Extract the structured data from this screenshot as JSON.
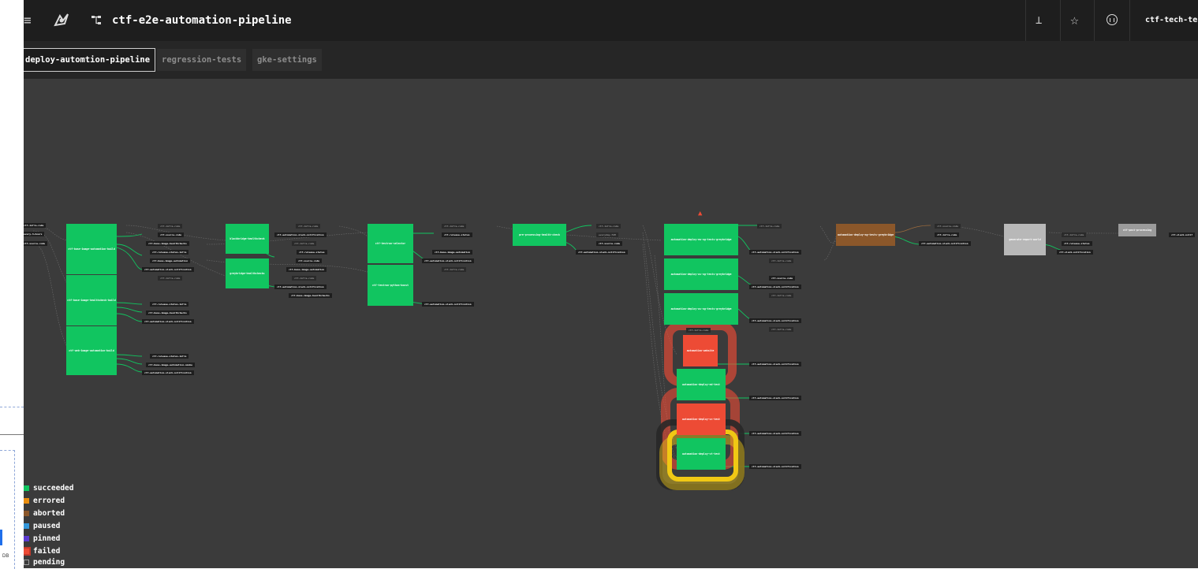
{
  "topbar": {
    "pipeline_name": "ctf-e2e-automation-pipeline",
    "team_label": "ctf-tech-tes"
  },
  "groups": [
    {
      "label": "deploy-automtion-pipeline",
      "active": true
    },
    {
      "label": "regression-tests",
      "active": false
    },
    {
      "label": "gke-settings",
      "active": false
    }
  ],
  "jobs": [
    {
      "name": "ctf-base-image-automation-build",
      "status": "succeeded"
    },
    {
      "name": "ctf-base-image-healthcheck-build",
      "status": "succeeded"
    },
    {
      "name": "ctf-web-image-automation-build",
      "status": "succeeded"
    },
    {
      "name": "blackbridge-healthcheck",
      "status": "succeeded"
    },
    {
      "name": "greybridge-healthchecks",
      "status": "succeeded"
    },
    {
      "name": "ctf-testrun-selector",
      "status": "succeeded"
    },
    {
      "name": "ctf-testrun-python-boost",
      "status": "succeeded"
    },
    {
      "name": "pre-processing-health-check",
      "status": "succeeded"
    },
    {
      "name": "automation-deploy-eu-ng-tests-greybridge",
      "status": "succeeded"
    },
    {
      "name": "automation-deploy-us-ng-tests-greybridge",
      "status": "succeeded"
    },
    {
      "name": "automation-deploy-us-ng-tests-greybridge",
      "status": "succeeded"
    },
    {
      "name": "automation-website",
      "status": "failed"
    },
    {
      "name": "automation-deploy-ed-test",
      "status": "succeeded"
    },
    {
      "name": "automation-deploy-vc-test",
      "status": "failed"
    },
    {
      "name": "automation-deploy-vt-test",
      "status": "succeeded"
    },
    {
      "name": "automation-deploy-ng-tests-greybridge",
      "status": "aborted"
    },
    {
      "name": "generate-report-world",
      "status": "pending"
    },
    {
      "name": "ctf-post-processing",
      "status": "pending"
    }
  ],
  "resources": {
    "left_inputs": [
      "ctf-infra-code",
      "every-3-hours",
      "ctf-source-code"
    ],
    "col1_a": [
      "ctf-infra-code",
      "ctf-source-code",
      "ctf-base-image-healthchecks",
      "ctf-release-status-infra",
      "ctf-base-image-automation",
      "ctf-automation-slack-notification"
    ],
    "col1_b": [
      "ctf-infra-code",
      "ctf-release-status-infra",
      "ctf-base-image-healthchecks",
      "ctf-automation-slack-notification"
    ],
    "col1_c": [
      "ctf-release-status-infra",
      "ctf-base-image-automation-smoke",
      "ctf-automation-slack-notification"
    ],
    "col2": [
      "ctf-infra-code",
      "ctf-automation-slack-notification",
      "ctf-infra-code",
      "ctf-release-status",
      "ctf-source-code",
      "ctf-base-image-automation",
      "ctf-infra-code",
      "ctf-automation-slack-notification",
      "ctf-base-image-healthchecks"
    ],
    "col3": [
      "ctf-infra-code",
      "ctf-release-status",
      "ctf-base-image-automation",
      "ctf-automation-slack-notification",
      "ctf-infra-code",
      "ctf-automation-slack-notification"
    ],
    "col4": [
      "ctf-infra-code",
      "everyday-7AM",
      "ctf-source-code",
      "ctf-automation-slack-notification"
    ],
    "col5": [
      "ctf-infra-code",
      "ctf-automation-slack-notification",
      "ctf-infra-code",
      "ctf-source-code",
      "ctf-automation-slack-notification",
      "ctf-infra-code",
      "ctf-automation-slack-notification",
      "ctf-infra-code",
      "ctf-automation-slack-notification",
      "ctf-automation-slack-notification",
      "ctf-automation-slack-notification",
      "ctf-automation-slack-notification"
    ],
    "inner": [
      "ctf-infra-code"
    ],
    "col6": [
      "ctf-source-code",
      "ctf-infra-code",
      "ctf-automation-slack-notification"
    ],
    "col7": [
      "ctf-infra-code",
      "ctf-release-status",
      "ctf-slack-notification"
    ],
    "col8": [
      "ctf-slack-notif"
    ]
  },
  "legend": [
    {
      "label": "succeeded",
      "color": "#11c560"
    },
    {
      "label": "errored",
      "color": "#e98e0f"
    },
    {
      "label": "aborted",
      "color": "#8b572a"
    },
    {
      "label": "paused",
      "color": "#3498db"
    },
    {
      "label": "pinned",
      "color": "#5c3bd1"
    },
    {
      "label": "failed",
      "color": "#ed4b35"
    },
    {
      "label": "pending",
      "color": "#9b9b9b"
    }
  ],
  "sidebar_fragment": {
    "text": "DB"
  }
}
